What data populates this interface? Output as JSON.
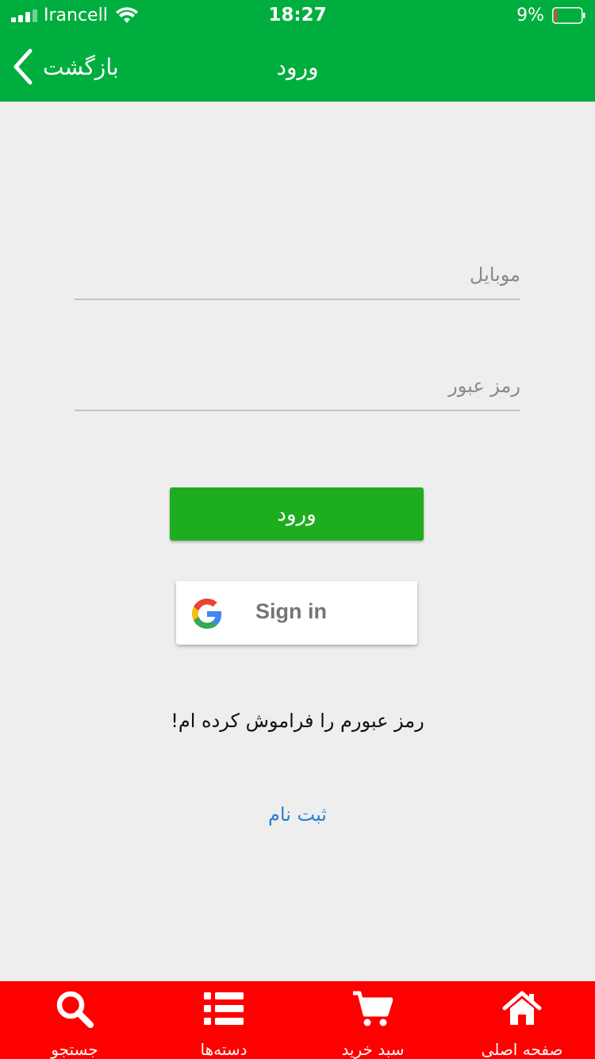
{
  "status_bar": {
    "carrier": "Irancell",
    "time": "18:27",
    "battery_percent": "9%",
    "battery_level": 0.09,
    "battery_color": "#ff3b30"
  },
  "nav": {
    "back_label": "بازگشت",
    "title": "ورود"
  },
  "form": {
    "mobile_placeholder": "موبایل",
    "password_placeholder": "رمز عبور",
    "login_label": "ورود",
    "google_label": "Sign in",
    "forgot_label": "رمز عبورم را فراموش کرده ام!",
    "register_label": "ثبت نام"
  },
  "tabs": [
    {
      "label": "جستجو",
      "icon": "search-icon"
    },
    {
      "label": "دسته‌ها",
      "icon": "list-icon"
    },
    {
      "label": "سبد خرید",
      "icon": "cart-icon"
    },
    {
      "label": "صفحه اصلی",
      "icon": "home-icon"
    }
  ],
  "colors": {
    "header": "#00ae3f",
    "login_button": "#1fad20",
    "tab_bar": "#ff0000",
    "register_link": "#2a7fd4"
  }
}
